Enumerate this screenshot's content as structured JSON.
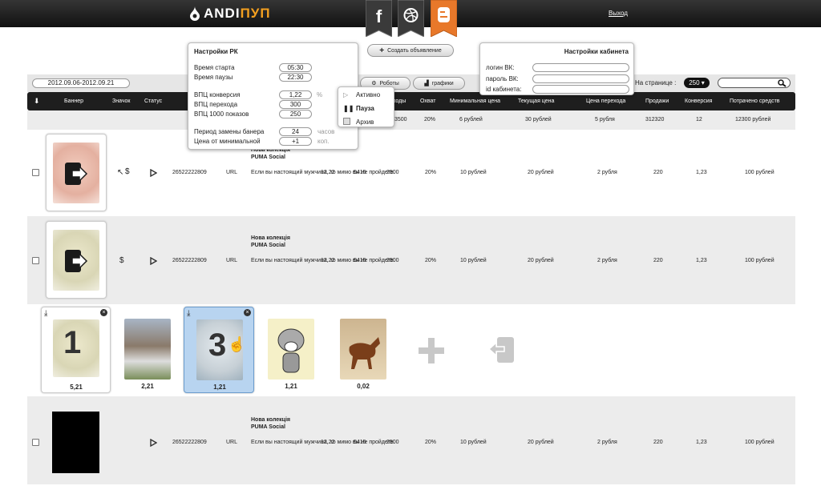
{
  "app": {
    "logo_main": "ANDI",
    "logo_accent": "ПУП",
    "logout": "Выход"
  },
  "social": [
    "facebook",
    "dribbble",
    "blogger"
  ],
  "colors": {
    "accent": "#f4a020",
    "header_bg": "#1e1e1e",
    "row_alt": "#ececec",
    "selected": "#b8d4f0"
  },
  "toolbar": {
    "create_ad": "Создать объявление",
    "robots": "Роботы",
    "charts": "графики",
    "per_page_label": "На странице :",
    "per_page_value": "250"
  },
  "filter": {
    "date_range": "2012.09.06-2012.09.21"
  },
  "table": {
    "headers": [
      "Баннер",
      "Значок",
      "Статус",
      "ходы",
      "Охват",
      "Минимальная цена",
      "Текущая цена",
      "Цена перехода",
      "Продажи",
      "Конверсия",
      "Потрачено средств"
    ],
    "top_row": [
      "3500",
      "20%",
      "6 рублей",
      "30 рублей",
      "5 рубля",
      "312320",
      "12",
      "12300 рублей"
    ],
    "rows": [
      {
        "id": "26522222809",
        "type": "URL",
        "title": "Нова колекція\nPUMA Social",
        "desc": "Если вы настоящий мужчина, то мимо вы не пройдете.",
        "ctr": "12,22",
        "shows": "5415",
        "clicks": "2500",
        "reach": "20%",
        "min": "10 рублей",
        "cur": "20 рублей",
        "click_price": "2 рубля",
        "sales": "220",
        "conv": "1,23",
        "spent": "100 рублей",
        "icon": "$"
      },
      {
        "id": "26522222809",
        "type": "URL",
        "title": "Нова колекція\nPUMA Social",
        "desc": "Если вы настоящий мужчина, то мимо вы не пройдете.",
        "ctr": "12,22",
        "shows": "5415",
        "clicks": "2500",
        "reach": "20%",
        "min": "10 рублей",
        "cur": "20 рублей",
        "click_price": "2 рубля",
        "sales": "220",
        "conv": "1,23",
        "spent": "100 рублей",
        "icon": "$"
      },
      {
        "id": "26522222809",
        "type": "URL",
        "title": "Нова колекція\nPUMA Social",
        "desc": "Если вы настоящий мужчина, то мимо вы не пройдете.",
        "ctr": "12,22",
        "shows": "5415",
        "clicks": "2500",
        "reach": "20%",
        "min": "10 рублей",
        "cur": "20 рублей",
        "click_price": "2 рубля",
        "sales": "220",
        "conv": "1,23",
        "spent": "100 рублей",
        "icon": ""
      }
    ]
  },
  "banners": [
    {
      "value": "5,21",
      "label": "1"
    },
    {
      "value": "2,21",
      "label": ""
    },
    {
      "value": "1,21",
      "label": "3"
    },
    {
      "value": "1,21",
      "label": ""
    },
    {
      "value": "0,02",
      "label": ""
    }
  ],
  "rk_settings": {
    "title": "Настройки РК",
    "start_label": "Время старта",
    "start": "05:30",
    "pause_label": "Время паузы",
    "pause": "22:30",
    "conv_label": "ВПЦ конверсия",
    "conv": "1,22",
    "conv_unit": "%",
    "click_label": "ВПЦ перехода",
    "click": "300",
    "shows_label": "ВПЦ 1000 показов",
    "shows": "250",
    "period_label": "Период замены банера",
    "period": "24",
    "period_unit": "часов",
    "min_label": "Цена от минимальной",
    "min": "+1",
    "min_unit": "коп."
  },
  "status_menu": {
    "active": "Активно",
    "pause": "Пауза",
    "archive": "Архив"
  },
  "cabinet": {
    "title": "Настройки кабинета",
    "login": "логин ВК:",
    "password": "пароль ВК:",
    "id": "id кабинета:"
  }
}
